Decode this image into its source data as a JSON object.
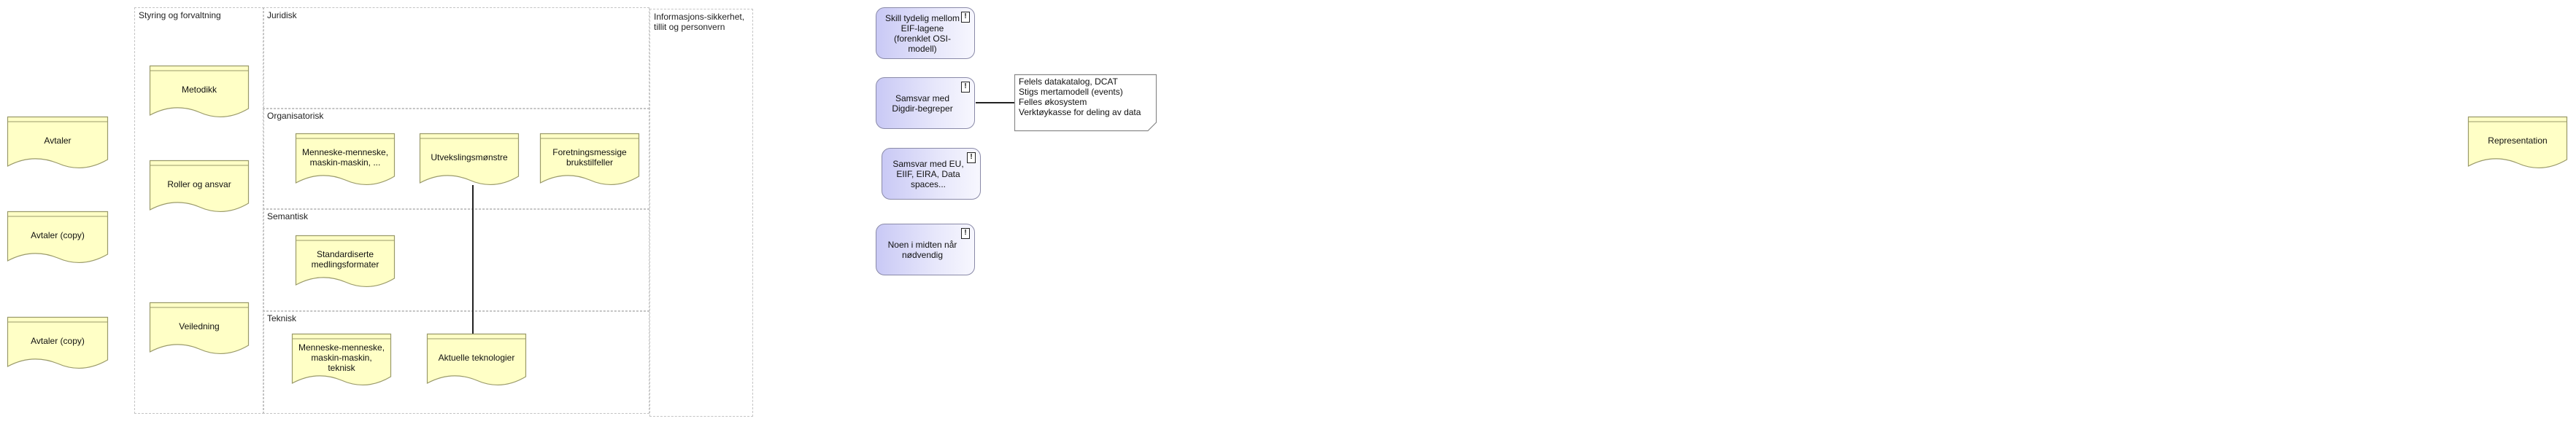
{
  "groups": {
    "styring": "Styring og forvaltning",
    "juridisk": "Juridisk",
    "organisatorisk": "Organisatorisk",
    "semantisk": "Semantisk",
    "teknisk": "Teknisk",
    "infosikkerhet": "Informasjons-sikkerhet,\ntillit og personvern"
  },
  "artifacts": {
    "avtaler": "Avtaler",
    "avtaler_copy_1": "Avtaler (copy)",
    "avtaler_copy_2": "Avtaler (copy)",
    "metodikk": "Metodikk",
    "roller": "Roller og ansvar",
    "veiledning": "Veiledning",
    "menneske_org": "Menneske-menneske, maskin-maskin, ...",
    "utvekslingsmonstre": "Utvekslingsmønstre",
    "foretningsmessige": "Foretningsmessige brukstilfeller",
    "standardiserte": "Standardiserte medlingsformater",
    "menneske_teknisk": "Menneske-menneske, maskin-maskin, teknisk",
    "aktuelle": "Aktuelle teknologier",
    "representation": "Representation"
  },
  "principles": {
    "skill": "Skill tydelig mellom EIF-lagene (forenklet OSI-modell)",
    "samsvar_digdir": "Samsvar med Digdir-begreper",
    "samsvar_eu": "Samsvar med EU, EIIF, EIRA, Data spaces...",
    "noen": "Noen i midten når nødvendig",
    "badge": "!"
  },
  "note": {
    "lines": [
      "Felels datakatalog, DCAT",
      "Stigs mertamodell (events)",
      "Felles økosystem",
      "Verktøykasse for deling av data"
    ]
  },
  "colors": {
    "artifact_fill": "#ffffc6",
    "artifact_stroke": "#9a9a6a",
    "principle_fill": "#c9c9f5",
    "group_border": "#c4c4c4"
  }
}
